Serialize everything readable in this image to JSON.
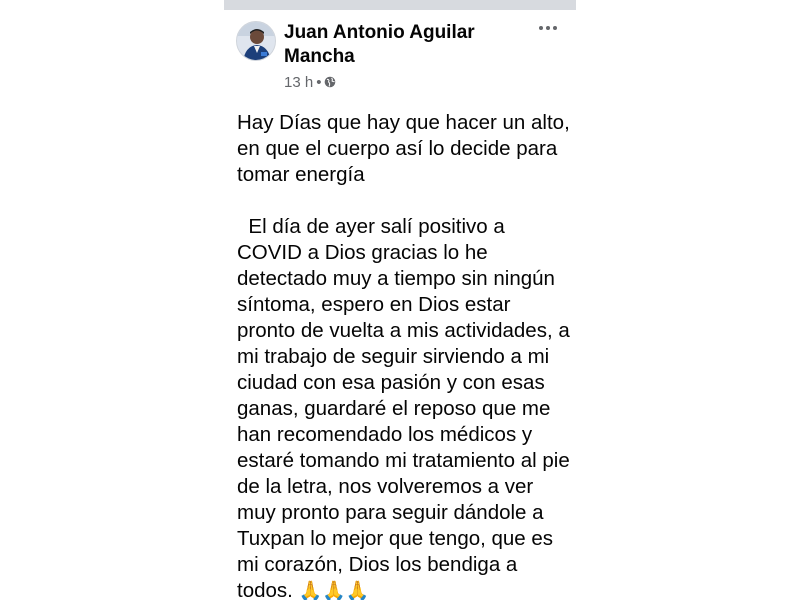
{
  "post": {
    "author": "Juan Antonio Aguilar Mancha",
    "timestamp": "13 h",
    "separator": "•",
    "privacy_icon": "globe-icon",
    "more_icon": "more-options-icon",
    "paragraph1": "Hay Días que hay que hacer un alto, en que el cuerpo así lo decide para tomar energía",
    "paragraph2": "  El día de ayer salí positivo a COVID a Dios gracias lo he detectado muy a tiempo sin ningún síntoma, espero en Dios estar pronto de vuelta a mis actividades, a mi trabajo de seguir sirviendo a mi ciudad con esa pasión y con esas ganas, guardaré el reposo que me han recomendado los médicos y estaré tomando mi tratamiento al pie de la letra, nos volveremos a ver muy pronto para seguir dándole a Tuxpan lo mejor que tengo, que es mi corazón, Dios los bendiga a todos. ",
    "emoji": "🙏🙏🙏"
  },
  "colors": {
    "text": "#050505",
    "secondary_text": "#65676b",
    "topbar": "#d7dadf"
  }
}
